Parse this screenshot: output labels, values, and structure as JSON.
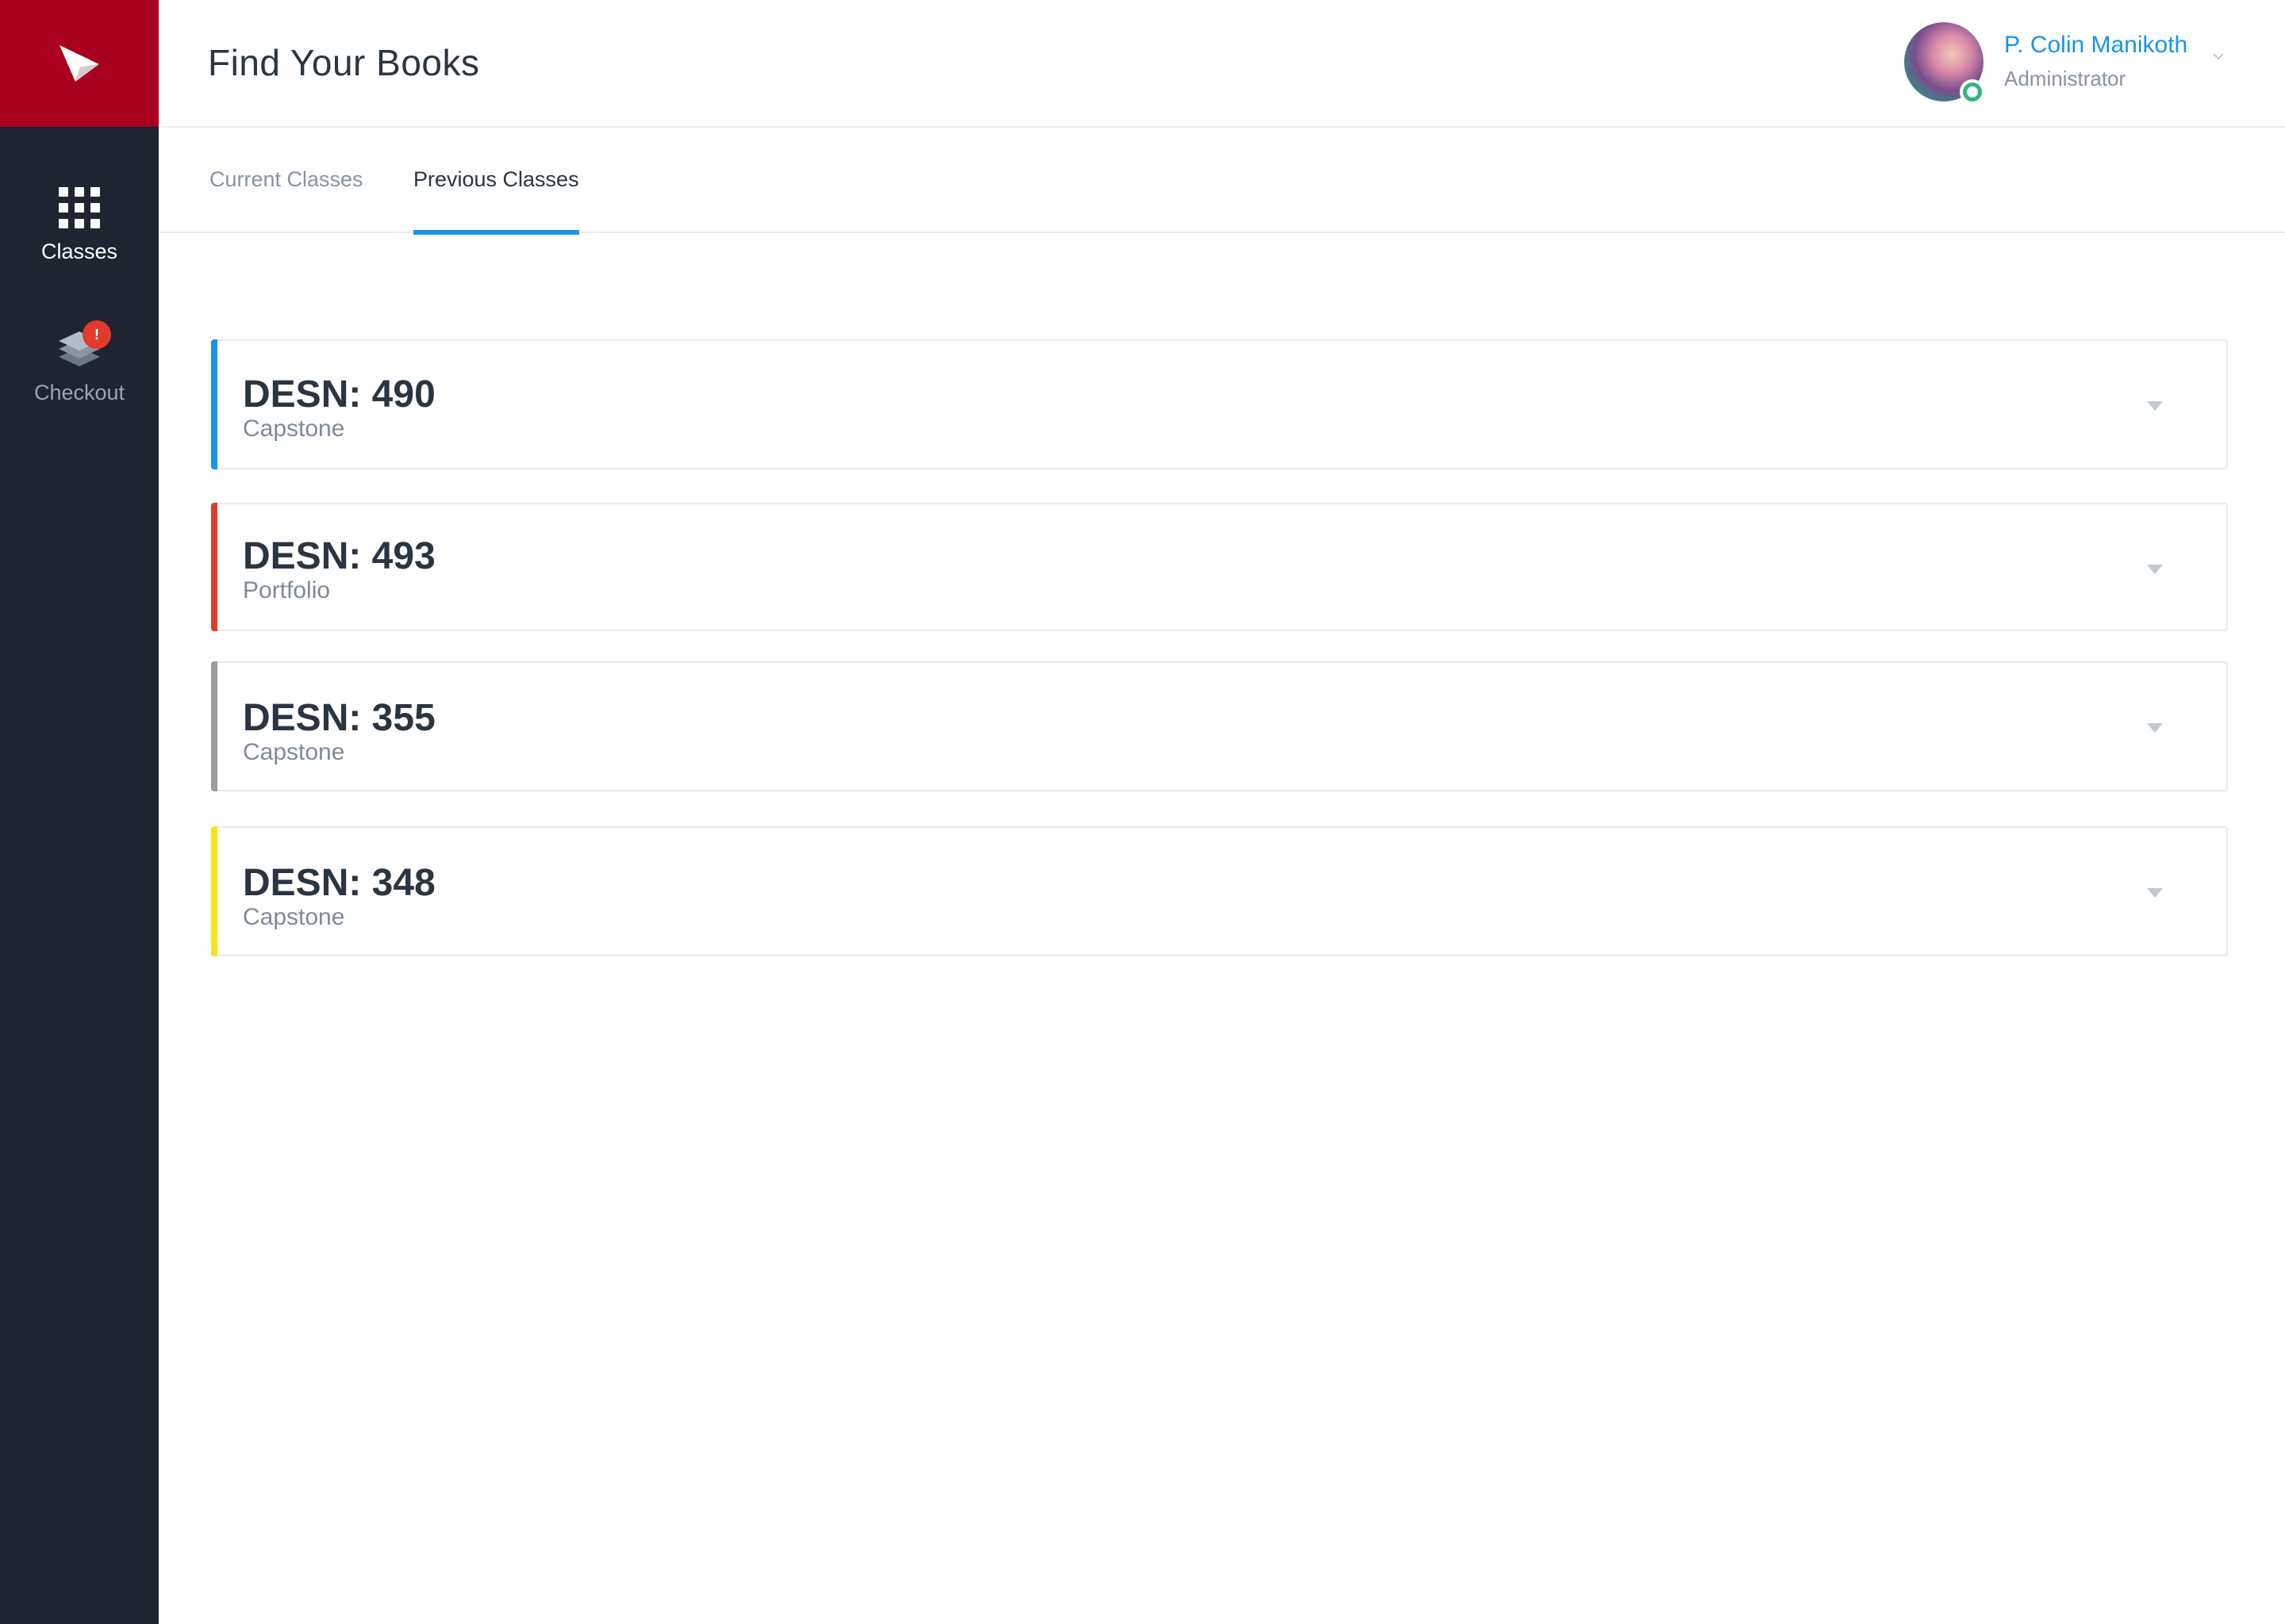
{
  "app": {
    "title": "Find Your Books"
  },
  "sidebar": {
    "items": [
      {
        "label": "Classes",
        "icon": "grid-icon",
        "active": true
      },
      {
        "label": "Checkout",
        "icon": "stack-icon",
        "active": false,
        "badge": "!"
      }
    ]
  },
  "user": {
    "name": "P. Colin Manikoth",
    "role": "Administrator",
    "status": "online"
  },
  "tabs": [
    {
      "label": "Current Classes",
      "active": false
    },
    {
      "label": "Previous Classes",
      "active": true
    }
  ],
  "classes": [
    {
      "code": "DESN: 490",
      "name": "Capstone",
      "color": "#1a94e6"
    },
    {
      "code": "DESN: 493",
      "name": "Portfolio",
      "color": "#e23b2e"
    },
    {
      "code": "DESN: 355",
      "name": "Capstone",
      "color": "#9b9b9b"
    },
    {
      "code": "DESN: 348",
      "name": "Capstone",
      "color": "#f2e51b"
    }
  ],
  "colors": {
    "brand": "#a8001f",
    "sidebar": "#1e2430",
    "accent": "#1a94e6",
    "online": "#2fb67a"
  }
}
